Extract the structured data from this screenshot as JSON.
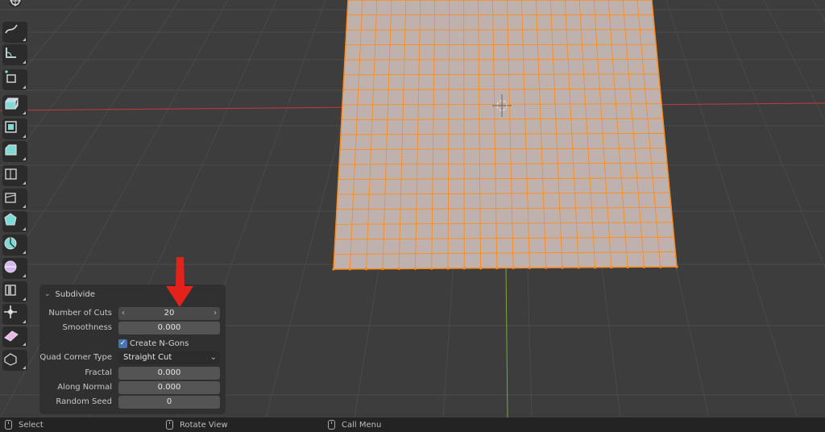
{
  "toolbar": {
    "tools": [
      {
        "name": "cursor-tool-icon"
      },
      {
        "name": "annotate-tool-icon"
      },
      {
        "name": "measure-tool-icon"
      },
      {
        "name": "add-cube-tool-icon"
      },
      {
        "name": "extrude-region-tool-icon"
      },
      {
        "name": "inset-faces-tool-icon"
      },
      {
        "name": "bevel-tool-icon"
      },
      {
        "name": "loop-cut-tool-icon"
      },
      {
        "name": "knife-tool-icon"
      },
      {
        "name": "poly-build-tool-icon"
      },
      {
        "name": "spin-tool-icon"
      },
      {
        "name": "smooth-tool-icon"
      },
      {
        "name": "edge-slide-tool-icon"
      },
      {
        "name": "shrink-fatten-tool-icon"
      },
      {
        "name": "shear-tool-icon"
      },
      {
        "name": "rip-region-tool-icon"
      }
    ]
  },
  "operator": {
    "title": "Subdivide",
    "fields": {
      "number_of_cuts": {
        "label": "Number of Cuts",
        "value": "20"
      },
      "smoothness": {
        "label": "Smoothness",
        "value": "0.000"
      },
      "create_ngons": {
        "label": "Create N-Gons",
        "checked": true
      },
      "quad_corner_type": {
        "label": "Quad Corner Type",
        "value": "Straight Cut"
      },
      "fractal": {
        "label": "Fractal",
        "value": "0.000"
      },
      "along_normal": {
        "label": "Along Normal",
        "value": "0.000"
      },
      "random_seed": {
        "label": "Random Seed",
        "value": "0"
      }
    }
  },
  "statusbar": {
    "select": "Select",
    "rotate_view": "Rotate View",
    "call_menu": "Call Menu"
  },
  "colors": {
    "viewport_bg": "#3d3d3d",
    "mesh_face": "#bfb2ae",
    "mesh_edge": "#ff8c1a",
    "x_axis": "#c23b3b",
    "y_axis": "#7ba83a",
    "annotation_arrow": "#e3221c"
  }
}
